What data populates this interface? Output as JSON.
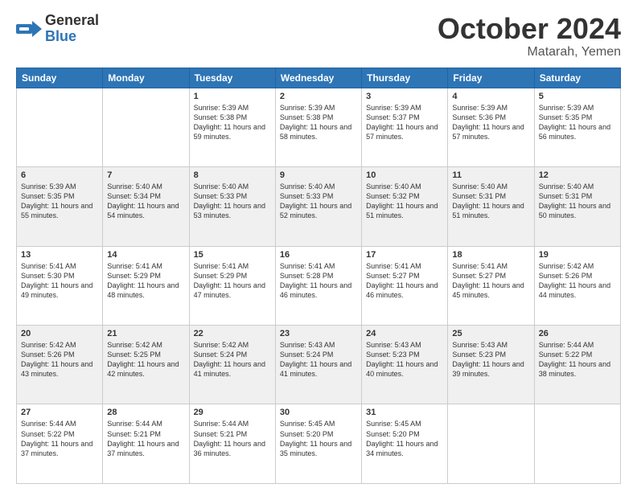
{
  "header": {
    "logo_line1": "General",
    "logo_line2": "Blue",
    "month": "October 2024",
    "location": "Matarah, Yemen"
  },
  "days_of_week": [
    "Sunday",
    "Monday",
    "Tuesday",
    "Wednesday",
    "Thursday",
    "Friday",
    "Saturday"
  ],
  "weeks": [
    [
      {
        "day": "",
        "sunrise": "",
        "sunset": "",
        "daylight": ""
      },
      {
        "day": "",
        "sunrise": "",
        "sunset": "",
        "daylight": ""
      },
      {
        "day": "1",
        "sunrise": "Sunrise: 5:39 AM",
        "sunset": "Sunset: 5:38 PM",
        "daylight": "Daylight: 11 hours and 59 minutes."
      },
      {
        "day": "2",
        "sunrise": "Sunrise: 5:39 AM",
        "sunset": "Sunset: 5:38 PM",
        "daylight": "Daylight: 11 hours and 58 minutes."
      },
      {
        "day": "3",
        "sunrise": "Sunrise: 5:39 AM",
        "sunset": "Sunset: 5:37 PM",
        "daylight": "Daylight: 11 hours and 57 minutes."
      },
      {
        "day": "4",
        "sunrise": "Sunrise: 5:39 AM",
        "sunset": "Sunset: 5:36 PM",
        "daylight": "Daylight: 11 hours and 57 minutes."
      },
      {
        "day": "5",
        "sunrise": "Sunrise: 5:39 AM",
        "sunset": "Sunset: 5:35 PM",
        "daylight": "Daylight: 11 hours and 56 minutes."
      }
    ],
    [
      {
        "day": "6",
        "sunrise": "Sunrise: 5:39 AM",
        "sunset": "Sunset: 5:35 PM",
        "daylight": "Daylight: 11 hours and 55 minutes."
      },
      {
        "day": "7",
        "sunrise": "Sunrise: 5:40 AM",
        "sunset": "Sunset: 5:34 PM",
        "daylight": "Daylight: 11 hours and 54 minutes."
      },
      {
        "day": "8",
        "sunrise": "Sunrise: 5:40 AM",
        "sunset": "Sunset: 5:33 PM",
        "daylight": "Daylight: 11 hours and 53 minutes."
      },
      {
        "day": "9",
        "sunrise": "Sunrise: 5:40 AM",
        "sunset": "Sunset: 5:33 PM",
        "daylight": "Daylight: 11 hours and 52 minutes."
      },
      {
        "day": "10",
        "sunrise": "Sunrise: 5:40 AM",
        "sunset": "Sunset: 5:32 PM",
        "daylight": "Daylight: 11 hours and 51 minutes."
      },
      {
        "day": "11",
        "sunrise": "Sunrise: 5:40 AM",
        "sunset": "Sunset: 5:31 PM",
        "daylight": "Daylight: 11 hours and 51 minutes."
      },
      {
        "day": "12",
        "sunrise": "Sunrise: 5:40 AM",
        "sunset": "Sunset: 5:31 PM",
        "daylight": "Daylight: 11 hours and 50 minutes."
      }
    ],
    [
      {
        "day": "13",
        "sunrise": "Sunrise: 5:41 AM",
        "sunset": "Sunset: 5:30 PM",
        "daylight": "Daylight: 11 hours and 49 minutes."
      },
      {
        "day": "14",
        "sunrise": "Sunrise: 5:41 AM",
        "sunset": "Sunset: 5:29 PM",
        "daylight": "Daylight: 11 hours and 48 minutes."
      },
      {
        "day": "15",
        "sunrise": "Sunrise: 5:41 AM",
        "sunset": "Sunset: 5:29 PM",
        "daylight": "Daylight: 11 hours and 47 minutes."
      },
      {
        "day": "16",
        "sunrise": "Sunrise: 5:41 AM",
        "sunset": "Sunset: 5:28 PM",
        "daylight": "Daylight: 11 hours and 46 minutes."
      },
      {
        "day": "17",
        "sunrise": "Sunrise: 5:41 AM",
        "sunset": "Sunset: 5:27 PM",
        "daylight": "Daylight: 11 hours and 46 minutes."
      },
      {
        "day": "18",
        "sunrise": "Sunrise: 5:41 AM",
        "sunset": "Sunset: 5:27 PM",
        "daylight": "Daylight: 11 hours and 45 minutes."
      },
      {
        "day": "19",
        "sunrise": "Sunrise: 5:42 AM",
        "sunset": "Sunset: 5:26 PM",
        "daylight": "Daylight: 11 hours and 44 minutes."
      }
    ],
    [
      {
        "day": "20",
        "sunrise": "Sunrise: 5:42 AM",
        "sunset": "Sunset: 5:26 PM",
        "daylight": "Daylight: 11 hours and 43 minutes."
      },
      {
        "day": "21",
        "sunrise": "Sunrise: 5:42 AM",
        "sunset": "Sunset: 5:25 PM",
        "daylight": "Daylight: 11 hours and 42 minutes."
      },
      {
        "day": "22",
        "sunrise": "Sunrise: 5:42 AM",
        "sunset": "Sunset: 5:24 PM",
        "daylight": "Daylight: 11 hours and 41 minutes."
      },
      {
        "day": "23",
        "sunrise": "Sunrise: 5:43 AM",
        "sunset": "Sunset: 5:24 PM",
        "daylight": "Daylight: 11 hours and 41 minutes."
      },
      {
        "day": "24",
        "sunrise": "Sunrise: 5:43 AM",
        "sunset": "Sunset: 5:23 PM",
        "daylight": "Daylight: 11 hours and 40 minutes."
      },
      {
        "day": "25",
        "sunrise": "Sunrise: 5:43 AM",
        "sunset": "Sunset: 5:23 PM",
        "daylight": "Daylight: 11 hours and 39 minutes."
      },
      {
        "day": "26",
        "sunrise": "Sunrise: 5:44 AM",
        "sunset": "Sunset: 5:22 PM",
        "daylight": "Daylight: 11 hours and 38 minutes."
      }
    ],
    [
      {
        "day": "27",
        "sunrise": "Sunrise: 5:44 AM",
        "sunset": "Sunset: 5:22 PM",
        "daylight": "Daylight: 11 hours and 37 minutes."
      },
      {
        "day": "28",
        "sunrise": "Sunrise: 5:44 AM",
        "sunset": "Sunset: 5:21 PM",
        "daylight": "Daylight: 11 hours and 37 minutes."
      },
      {
        "day": "29",
        "sunrise": "Sunrise: 5:44 AM",
        "sunset": "Sunset: 5:21 PM",
        "daylight": "Daylight: 11 hours and 36 minutes."
      },
      {
        "day": "30",
        "sunrise": "Sunrise: 5:45 AM",
        "sunset": "Sunset: 5:20 PM",
        "daylight": "Daylight: 11 hours and 35 minutes."
      },
      {
        "day": "31",
        "sunrise": "Sunrise: 5:45 AM",
        "sunset": "Sunset: 5:20 PM",
        "daylight": "Daylight: 11 hours and 34 minutes."
      },
      {
        "day": "",
        "sunrise": "",
        "sunset": "",
        "daylight": ""
      },
      {
        "day": "",
        "sunrise": "",
        "sunset": "",
        "daylight": ""
      }
    ]
  ]
}
